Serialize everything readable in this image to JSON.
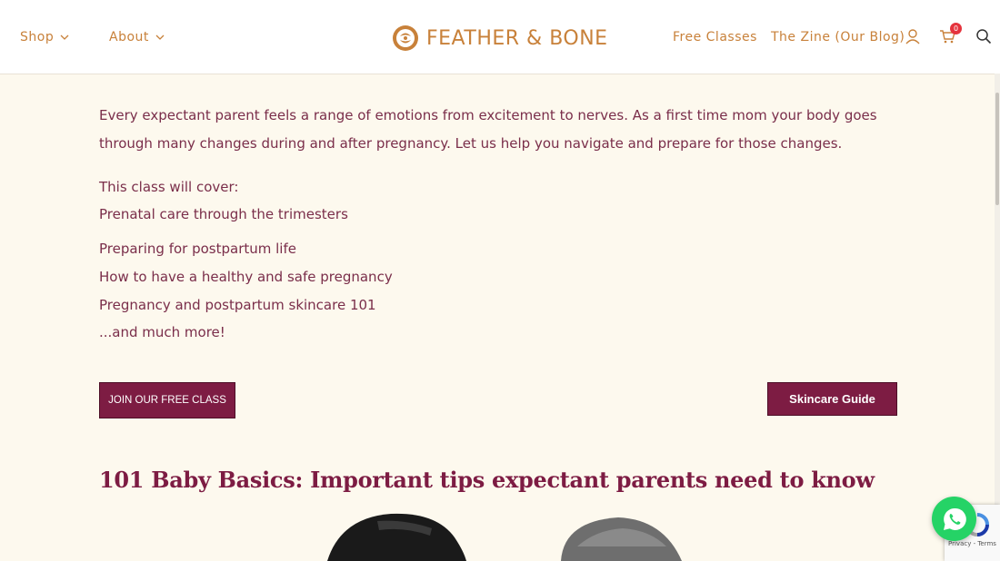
{
  "header": {
    "nav_left": [
      {
        "label": "Shop"
      },
      {
        "label": "About"
      }
    ],
    "logo_text": "FEATHER & BONE",
    "nav_right": [
      {
        "label": "Free Classes"
      },
      {
        "label": "The Zine (Our Blog)"
      }
    ],
    "cart_count": "0",
    "icons": [
      "user-icon",
      "cart-icon",
      "search-icon"
    ]
  },
  "main": {
    "intro": "Every expectant parent feels a range of emotions from excitement to nerves. As a first time mom your body goes through many changes during and after pregnancy. Let us help you navigate and prepare for those changes.",
    "cover_title": "This class will cover:",
    "cover_items": [
      "Prenatal care through the trimesters",
      "Preparing for postpartum life",
      "How to have a healthy and safe pregnancy",
      "Pregnancy and postpartum skincare 101",
      "...and much more!"
    ],
    "join_button": "JOIN OUR FREE CLASS",
    "guide_button": "Skincare Guide",
    "section_heading": "101 Baby Basics: Important tips expectant parents need to know"
  },
  "widgets": {
    "recaptcha_text": "Privacy - Terms"
  },
  "colors": {
    "accent": "#c8813a",
    "brand": "#7d1c43",
    "background": "#fdf9ee",
    "whatsapp": "#25d366"
  }
}
